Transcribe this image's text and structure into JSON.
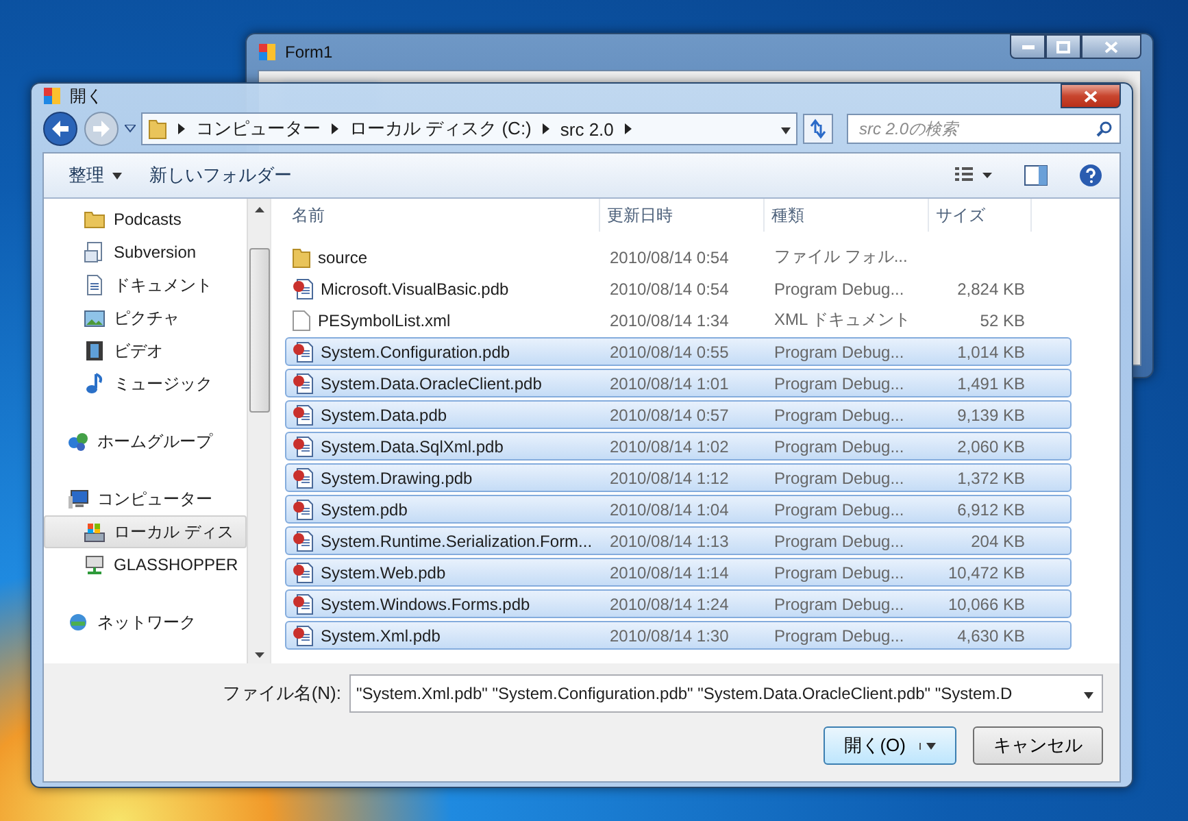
{
  "background_window": {
    "title": "Form1"
  },
  "dialog": {
    "title": "開く"
  },
  "address_bar": {
    "segments": [
      "コンピューター",
      "ローカル ディスク (C:)",
      "src 2.0"
    ]
  },
  "search": {
    "placeholder": "src 2.0の検索"
  },
  "toolbar": {
    "organize": "整理",
    "new_folder": "新しいフォルダー"
  },
  "sidebar": {
    "sections": [
      {
        "items": [
          {
            "label": "Podcasts",
            "kind": "folder",
            "selected": false
          },
          {
            "label": "Subversion",
            "kind": "repo",
            "selected": false
          },
          {
            "label": "ドキュメント",
            "kind": "document",
            "selected": false
          },
          {
            "label": "ピクチャ",
            "kind": "picture",
            "selected": false
          },
          {
            "label": "ビデオ",
            "kind": "video",
            "selected": false
          },
          {
            "label": "ミュージック",
            "kind": "music",
            "selected": false
          }
        ]
      },
      {
        "items": [
          {
            "label": "ホームグループ",
            "kind": "homegroup",
            "selected": false
          }
        ]
      },
      {
        "items": [
          {
            "label": "コンピューター",
            "kind": "computer",
            "selected": false
          },
          {
            "label": "ローカル ディス",
            "kind": "disk",
            "selected": true
          },
          {
            "label": "GLASSHOPPER",
            "kind": "netpc",
            "selected": false
          }
        ]
      },
      {
        "items": [
          {
            "label": "ネットワーク",
            "kind": "network",
            "selected": false
          }
        ]
      }
    ]
  },
  "table": {
    "columns": [
      "名前",
      "更新日時",
      "種類",
      "サイズ"
    ],
    "rows": [
      {
        "kind": "folder",
        "name": "source",
        "date": "2010/08/14 0:54",
        "type": "ファイル フォル...",
        "size": "",
        "selected": false
      },
      {
        "kind": "pdb",
        "name": "Microsoft.VisualBasic.pdb",
        "date": "2010/08/14 0:54",
        "type": "Program Debug...",
        "size": "2,824 KB",
        "selected": false
      },
      {
        "kind": "xml",
        "name": "PESymbolList.xml",
        "date": "2010/08/14 1:34",
        "type": "XML ドキュメント",
        "size": "52 KB",
        "selected": false
      },
      {
        "kind": "pdb",
        "name": "System.Configuration.pdb",
        "date": "2010/08/14 0:55",
        "type": "Program Debug...",
        "size": "1,014 KB",
        "selected": true
      },
      {
        "kind": "pdb",
        "name": "System.Data.OracleClient.pdb",
        "date": "2010/08/14 1:01",
        "type": "Program Debug...",
        "size": "1,491 KB",
        "selected": true
      },
      {
        "kind": "pdb",
        "name": "System.Data.pdb",
        "date": "2010/08/14 0:57",
        "type": "Program Debug...",
        "size": "9,139 KB",
        "selected": true
      },
      {
        "kind": "pdb",
        "name": "System.Data.SqlXml.pdb",
        "date": "2010/08/14 1:02",
        "type": "Program Debug...",
        "size": "2,060 KB",
        "selected": true
      },
      {
        "kind": "pdb",
        "name": "System.Drawing.pdb",
        "date": "2010/08/14 1:12",
        "type": "Program Debug...",
        "size": "1,372 KB",
        "selected": true
      },
      {
        "kind": "pdb",
        "name": "System.pdb",
        "date": "2010/08/14 1:04",
        "type": "Program Debug...",
        "size": "6,912 KB",
        "selected": true
      },
      {
        "kind": "pdb",
        "name": "System.Runtime.Serialization.Form...",
        "date": "2010/08/14 1:13",
        "type": "Program Debug...",
        "size": "204 KB",
        "selected": true
      },
      {
        "kind": "pdb",
        "name": "System.Web.pdb",
        "date": "2010/08/14 1:14",
        "type": "Program Debug...",
        "size": "10,472 KB",
        "selected": true
      },
      {
        "kind": "pdb",
        "name": "System.Windows.Forms.pdb",
        "date": "2010/08/14 1:24",
        "type": "Program Debug...",
        "size": "10,066 KB",
        "selected": true
      },
      {
        "kind": "pdb",
        "name": "System.Xml.pdb",
        "date": "2010/08/14 1:30",
        "type": "Program Debug...",
        "size": "4,630 KB",
        "selected": true
      }
    ]
  },
  "file_name": {
    "label": "ファイル名(N):",
    "value": "\"System.Xml.pdb\" \"System.Configuration.pdb\" \"System.Data.OracleClient.pdb\" \"System.D"
  },
  "buttons": {
    "open": "開く(O)",
    "cancel": "キャンセル"
  }
}
